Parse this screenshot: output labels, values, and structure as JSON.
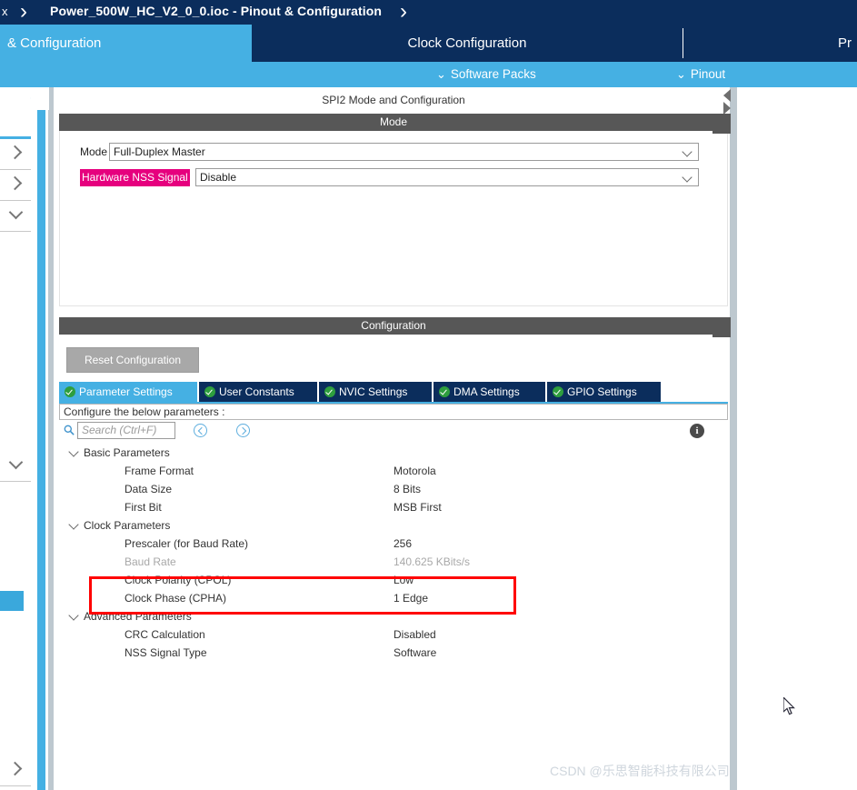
{
  "breadcrumb": {
    "close_label": "x",
    "title": "Power_500W_HC_V2_0_0.ioc - Pinout & Configuration",
    "separator": "›"
  },
  "main_tabs": [
    {
      "label": "& Configuration",
      "active": true
    },
    {
      "label": "Clock Configuration",
      "active": false
    },
    {
      "label": "Pr",
      "active": false
    }
  ],
  "sub_toolbar": {
    "items": [
      {
        "label": "Software Packs",
        "icon": "chevron-down-icon",
        "glyph": "⌄"
      },
      {
        "label": "Pinout",
        "icon": "chevron-down-icon",
        "glyph": "⌄"
      }
    ]
  },
  "sidebar": {
    "gear_icon": "gear-icon",
    "items": [
      {
        "icon": "chevron-right-icon",
        "dir": "right"
      },
      {
        "icon": "chevron-right-icon",
        "dir": "right"
      },
      {
        "icon": "chevron-down-icon",
        "dir": "down"
      },
      {
        "icon": "chevron-down-icon",
        "dir": "down"
      },
      {
        "icon": "chevron-right-icon",
        "dir": "right"
      }
    ]
  },
  "panel": {
    "title": "SPI2 Mode and Configuration",
    "mode_section_title": "Mode",
    "config_section_title": "Configuration"
  },
  "mode": {
    "fields": [
      {
        "label": "Mode",
        "value": "Full-Duplex Master",
        "highlighted": false
      },
      {
        "label": "Hardware NSS Signal",
        "value": "Disable",
        "highlighted": true
      }
    ]
  },
  "config": {
    "reset_label": "Reset Configuration",
    "tabs": [
      {
        "label": "Parameter Settings",
        "active": true
      },
      {
        "label": "User Constants",
        "active": false
      },
      {
        "label": "NVIC Settings",
        "active": false
      },
      {
        "label": "DMA Settings",
        "active": false
      },
      {
        "label": "GPIO Settings",
        "active": false
      }
    ],
    "note": "Configure the below parameters :",
    "search_placeholder": "Search (Ctrl+F)",
    "search_value": "",
    "search_icon": "magnifier-icon",
    "prev_icon": "chevron-left-circle-icon",
    "next_icon": "chevron-right-circle-icon",
    "info_icon": "info-icon",
    "info_glyph": "i"
  },
  "parameters": [
    {
      "group": "Basic Parameters",
      "rows": [
        {
          "name": "Frame Format",
          "value": "Motorola",
          "dim": false
        },
        {
          "name": "Data Size",
          "value": "8 Bits",
          "dim": false
        },
        {
          "name": "First Bit",
          "value": "MSB First",
          "dim": false
        }
      ]
    },
    {
      "group": "Clock Parameters",
      "rows": [
        {
          "name": "Prescaler (for Baud Rate)",
          "value": "256",
          "dim": false
        },
        {
          "name": "Baud Rate",
          "value": "140.625 KBits/s",
          "dim": true
        },
        {
          "name": "Clock Polarity (CPOL)",
          "value": "Low",
          "dim": false
        },
        {
          "name": "Clock Phase (CPHA)",
          "value": "1 Edge",
          "dim": false
        }
      ]
    },
    {
      "group": "Advanced Parameters",
      "rows": [
        {
          "name": "CRC Calculation",
          "value": "Disabled",
          "dim": false
        },
        {
          "name": "NSS Signal Type",
          "value": "Software",
          "dim": false
        }
      ]
    }
  ],
  "annotation": {
    "color": "#ff0000",
    "covers": [
      "Clock Polarity (CPOL)",
      "Clock Phase (CPHA)"
    ]
  },
  "watermark": {
    "text": "CSDN @乐思智能科技有限公司"
  },
  "colors": {
    "header_navy": "#0b2d5c",
    "accent_blue": "#45b0e3",
    "section_grey": "#575757",
    "highlight_pink": "#e6007e",
    "annotation_red": "#ff0000"
  }
}
